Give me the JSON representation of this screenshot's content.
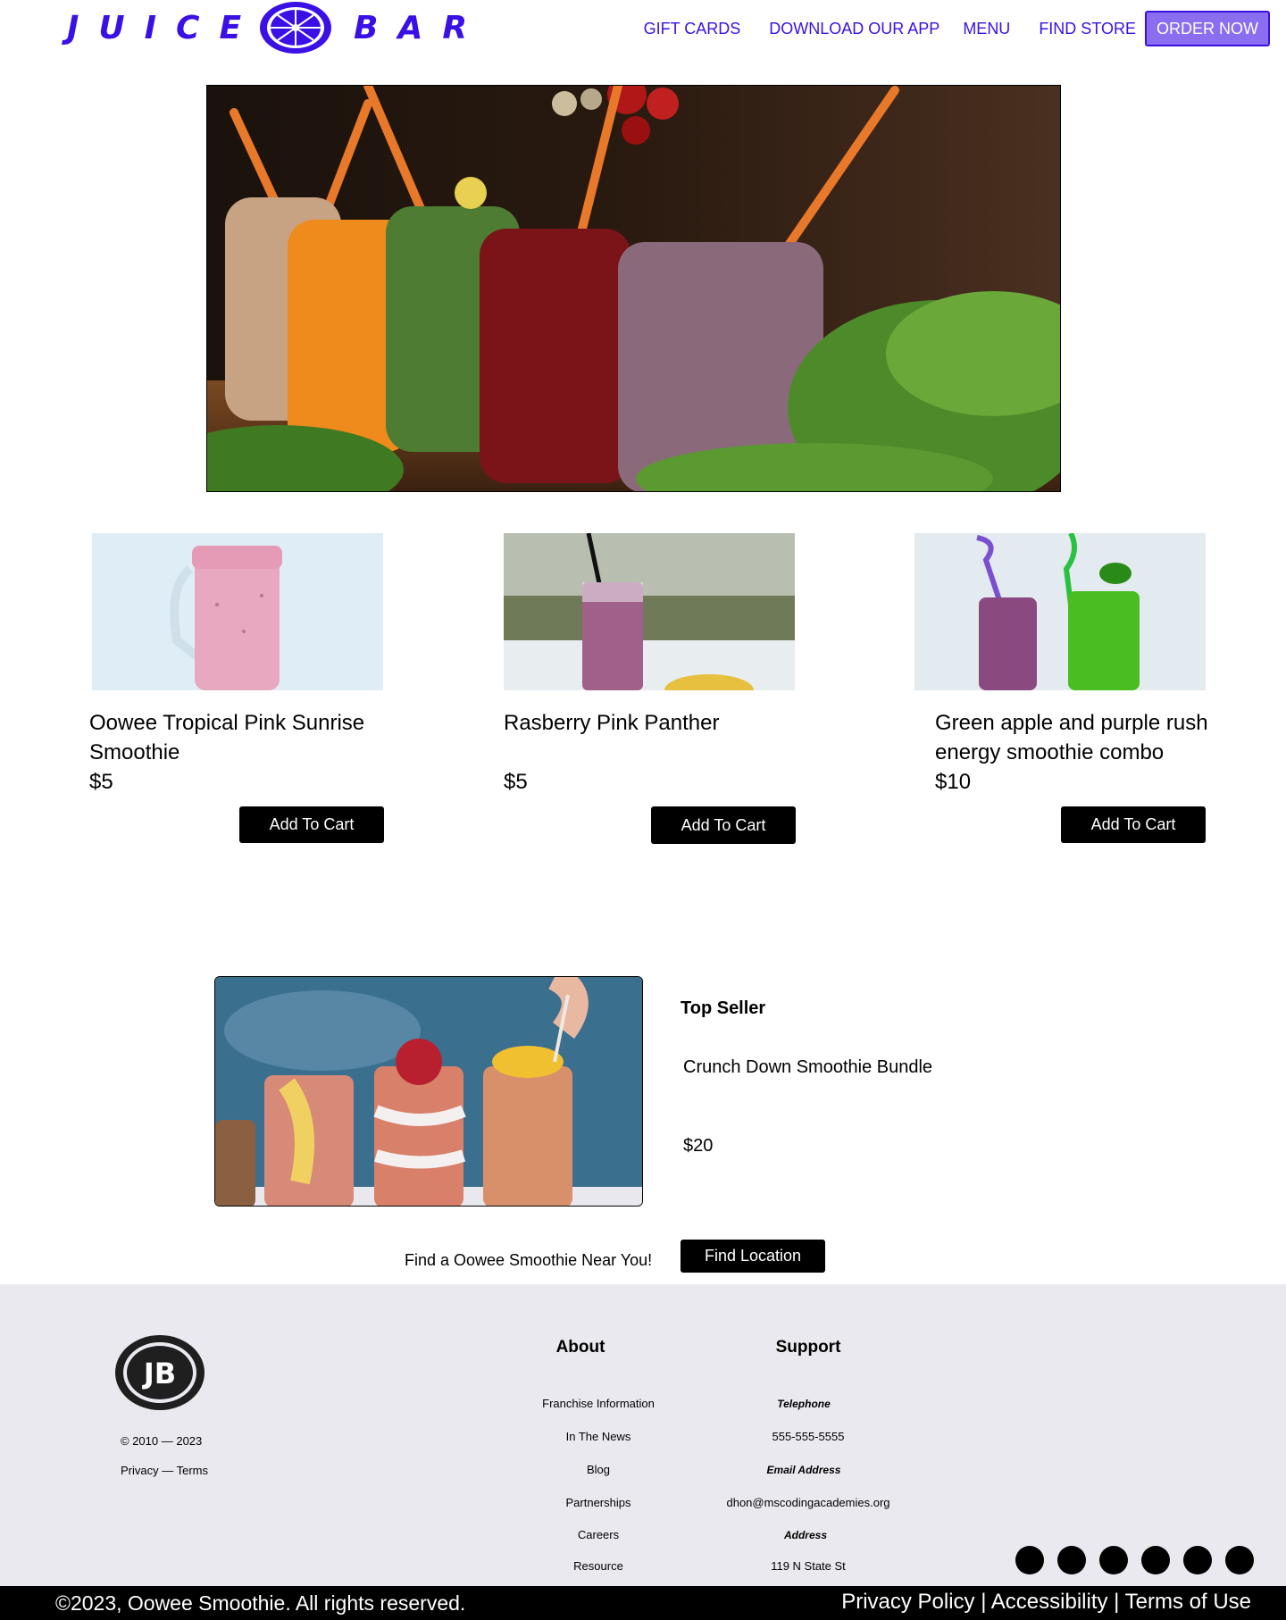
{
  "header": {
    "logo_left": "JUICE",
    "logo_right": "BAR",
    "nav": [
      "GIFT CARDS",
      "DOWNLOAD OUR APP",
      "MENU",
      "FIND STORE"
    ],
    "order_label": "ORDER NOW"
  },
  "products": [
    {
      "title": "Oowee Tropical Pink Sunrise Smoothie",
      "price": "$5",
      "button": "Add To Cart"
    },
    {
      "title": "Rasberry Pink Panther",
      "price": "$5",
      "button": "Add To Cart"
    },
    {
      "title": "Green apple and purple rush energy smoothie combo",
      "price": "$10",
      "button": "Add To Cart"
    }
  ],
  "top_seller": {
    "label": "Top Seller",
    "name": "Crunch Down Smoothie Bundle",
    "price": "$20"
  },
  "find": {
    "text": "Find a Oowee Smoothie Near You!",
    "button": "Find Location"
  },
  "footer": {
    "logo_text": "JB",
    "years": "© 2010 — 2023",
    "privacy_terms": "Privacy — Terms",
    "about": {
      "heading": "About",
      "items": [
        "Franchise Information",
        "In The News",
        "Blog",
        "Partnerships",
        "Careers",
        "Resource"
      ]
    },
    "support": {
      "heading": "Support",
      "telephone_label": "Telephone",
      "telephone": "555-555-5555",
      "email_label": "Email Address",
      "email": "dhon@mscodingacademies.org",
      "address_label": "Address",
      "address": "119 N State St"
    },
    "copyright": "©2023, Oowee Smoothie. All rights reserved.",
    "legal": "Privacy Policy | Accessibility | Terms of Use"
  },
  "colors": {
    "brand": "#3a10e5",
    "order_button": "#8b6df0",
    "footer_bg": "#ebe9f0"
  }
}
